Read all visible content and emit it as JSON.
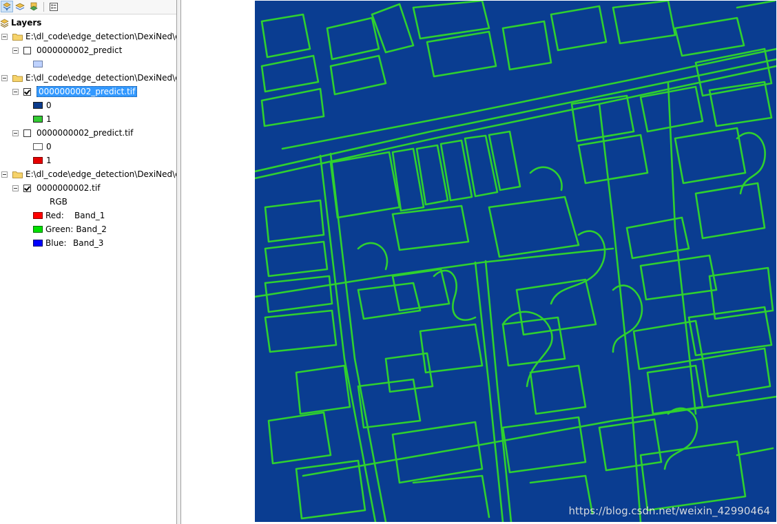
{
  "toc": {
    "title": "Layers",
    "groups": [
      {
        "path": "E:\\dl_code\\edge_detection\\DexiNed\\e",
        "layers": [
          {
            "name": "0000000002_predict",
            "checked": false,
            "legend": [
              {
                "label": "",
                "color": "#bed2ff"
              }
            ]
          }
        ]
      },
      {
        "path": "E:\\dl_code\\edge_detection\\DexiNed\\e",
        "layers": [
          {
            "name": "0000000002_predict.tif",
            "checked": true,
            "selected": true,
            "legend": [
              {
                "label": "0",
                "color": "#0b3b8c"
              },
              {
                "label": "1",
                "color": "#33cc33"
              }
            ]
          },
          {
            "name": "0000000002_predict.tif",
            "checked": false,
            "legend": [
              {
                "label": "0",
                "color": "#ffffff"
              },
              {
                "label": "1",
                "color": "#e60000"
              }
            ]
          }
        ]
      },
      {
        "path": "E:\\dl_code\\edge_detection\\DexiNed\\e",
        "layers": [
          {
            "name": "0000000002.tif",
            "checked": true,
            "rgb_label": "RGB",
            "bands": [
              {
                "label": "Red:",
                "band": "Band_1",
                "color": "#ff0000"
              },
              {
                "label": "Green:",
                "band": "Band_2",
                "color": "#00e000"
              },
              {
                "label": "Blue:",
                "band": "Band_3",
                "color": "#0000ff"
              }
            ]
          }
        ]
      }
    ]
  },
  "map": {
    "background": "#0a3d91",
    "edge_color": "#2fd12f",
    "watermark": "https://blog.csdn.net/weixin_42990464"
  },
  "icons": [
    "list-by-drawing-order-icon",
    "list-by-source-icon",
    "list-by-visibility-icon",
    "options-icon"
  ]
}
